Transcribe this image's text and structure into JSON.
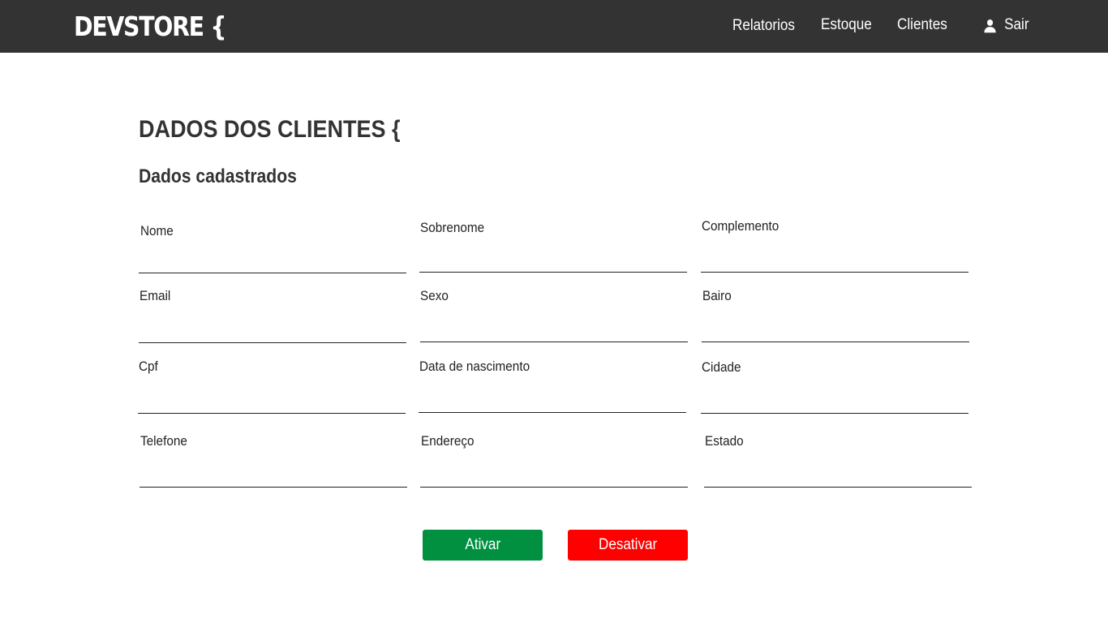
{
  "header": {
    "logo": "DEVSTORE {",
    "nav": {
      "relatorios": "Relatorios",
      "estoque": "Estoque",
      "clientes": "Clientes",
      "sair": "Sair"
    },
    "background_color": "#333333",
    "icons": {
      "sair": "person-icon"
    }
  },
  "main": {
    "page_title": "DADOS DOS CLIENTES {",
    "section_title": "Dados cadastrados",
    "fields": {
      "nome": {
        "label": "Nome",
        "value": ""
      },
      "sobrenome": {
        "label": "Sobrenome",
        "value": ""
      },
      "complemento": {
        "label": "Complemento",
        "value": ""
      },
      "email": {
        "label": "Email",
        "value": ""
      },
      "sexo": {
        "label": "Sexo",
        "value": ""
      },
      "bairo": {
        "label": "Bairo",
        "value": ""
      },
      "cpf": {
        "label": "Cpf",
        "value": ""
      },
      "data_nascimento": {
        "label": "Data de nascimento",
        "value": ""
      },
      "cidade": {
        "label": "Cidade",
        "value": ""
      },
      "telefone": {
        "label": "Telefone",
        "value": ""
      },
      "endereco": {
        "label": "Endereço",
        "value": ""
      },
      "estado": {
        "label": "Estado",
        "value": ""
      }
    },
    "buttons": {
      "ativar": "Ativar",
      "desativar": "Desativar"
    },
    "colors": {
      "ativar": "#009040",
      "desativar": "#ff0000"
    }
  }
}
